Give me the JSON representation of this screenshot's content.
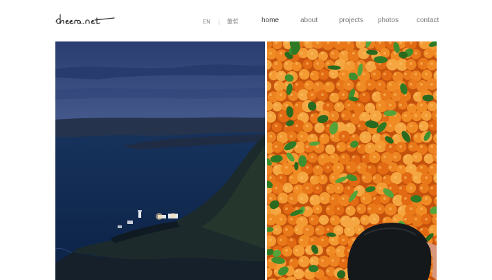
{
  "site": {
    "logo_text": "dheera.net"
  },
  "language": {
    "current": "EN",
    "separator": "|",
    "alternate": "董哲"
  },
  "nav": {
    "home": "home",
    "about": "about",
    "projects": "projects",
    "photos": "photos",
    "contact": "contact",
    "active": "home"
  },
  "gallery": {
    "left_photo": "coastal-lighthouse-at-dusk",
    "right_photo": "mandarin-oranges-market"
  },
  "colors": {
    "background": "#ffffff",
    "nav_text": "#777777",
    "nav_active": "#333333",
    "dusk_blue": "#2b3f73",
    "orange": "#e8741c",
    "leaf_green": "#3f8f2e"
  }
}
